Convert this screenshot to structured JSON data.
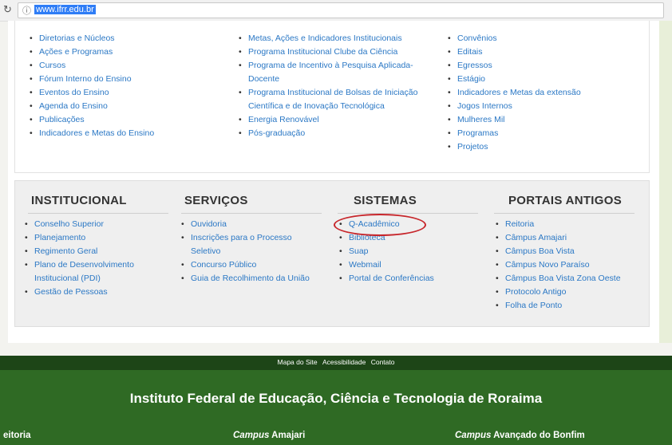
{
  "browser": {
    "reload_icon": "↻",
    "info_icon": "ⓘ",
    "url": "www.ifrr.edu.br"
  },
  "top_columns": {
    "col1": [
      "Diretorias e Núcleos",
      "Ações e Programas",
      "Cursos",
      "Fórum Interno do Ensino",
      "Eventos do Ensino",
      "Agenda do Ensino",
      "Publicações",
      "Indicadores e Metas do Ensino"
    ],
    "col2": [
      "Metas, Ações e Indicadores Institucionais",
      "Programa Institucional Clube da Ciência",
      "Programa de Incentivo à Pesquisa Aplicada-",
      "Docente",
      "Programa Institucional de Bolsas de Iniciação",
      "Científica e de Inovação Tecnológica",
      "Energia Renovável",
      "Pós-graduação"
    ],
    "col3": [
      "Convênios",
      "Editais",
      "Egressos",
      "Estágio",
      "Indicadores e Metas da extensão",
      "Jogos Internos",
      "Mulheres Mil",
      "Programas",
      "Projetos"
    ]
  },
  "sections": [
    {
      "title": "INSTITUCIONAL",
      "items": [
        "Conselho Superior",
        "Planejamento",
        "Regimento Geral",
        "Plano de Desenvolvimento",
        "Institucional (PDI)",
        "Gestão de Pessoas"
      ]
    },
    {
      "title": "SERVIÇOS",
      "items": [
        "Ouvidoria",
        "Inscrições para o Processo",
        "Seletivo",
        "Concurso Público",
        "Guia de Recolhimento da União"
      ]
    },
    {
      "title": "SISTEMAS",
      "items": [
        "Q-Acadêmico",
        "Biblioteca",
        "Suap",
        "Webmail",
        "Portal de Conferências"
      ]
    },
    {
      "title": "PORTAIS ANTIGOS",
      "items": [
        "Reitoria",
        "Câmpus Amajari",
        "Câmpus Boa Vista",
        "Câmpus Novo Paraíso",
        "Câmpus Boa Vista Zona Oeste",
        "Protocolo Antigo",
        "Folha de Ponto"
      ]
    }
  ],
  "footer": {
    "links": [
      "Mapa do Site",
      "Acessibilidade",
      "Contato"
    ],
    "institution": "Instituto Federal de Educação, Ciência e Tecnologia de Roraima",
    "campus_left": "eitoria",
    "campus_mid_prefix": "Campus",
    "campus_mid": "Amajari",
    "campus_right_prefix": "Campus",
    "campus_right": "Avançado do Bonfim"
  },
  "colors": {
    "link": "#2b78c5",
    "footer_dark": "#1d4517",
    "footer_main": "#2f6a24",
    "highlight": "#c7262b"
  }
}
